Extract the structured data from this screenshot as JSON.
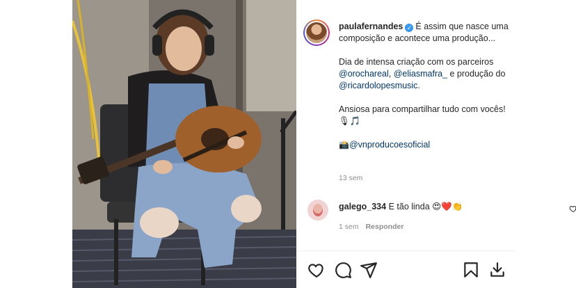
{
  "post": {
    "username": "paulafernandes",
    "verified_icon": "verified-badge-icon",
    "caption_line1": "É assim que nasce uma composição e acontece uma produção...",
    "caption_p2_text1": "Dia de intensa criação com os parceiros ",
    "caption_mention1": "@orochareal",
    "caption_comma": ", ",
    "caption_mention2": "@eliasmafra_",
    "caption_p2_text2": " e produção do ",
    "caption_mention3": "@ricardolopesmusic",
    "caption_period": ".",
    "caption_p3": "Ansiosa para compartilhar tudo com vocês! 🎙🎵",
    "caption_p4_emoji": "📸",
    "caption_mention4": "@vnproducoesoficial",
    "time_ago": "13 sem"
  },
  "comment": {
    "username": "galego_334",
    "text": "E tão linda 😍❤️👏",
    "time_ago": "1 sem",
    "reply_label": "Responder"
  },
  "actions": {
    "icons": [
      "heart-icon",
      "comment-icon",
      "share-icon",
      "save-icon",
      "download-icon"
    ]
  },
  "colors": {
    "mention": "#00376b",
    "muted": "#8e8e8e",
    "verified": "#3897f0"
  }
}
